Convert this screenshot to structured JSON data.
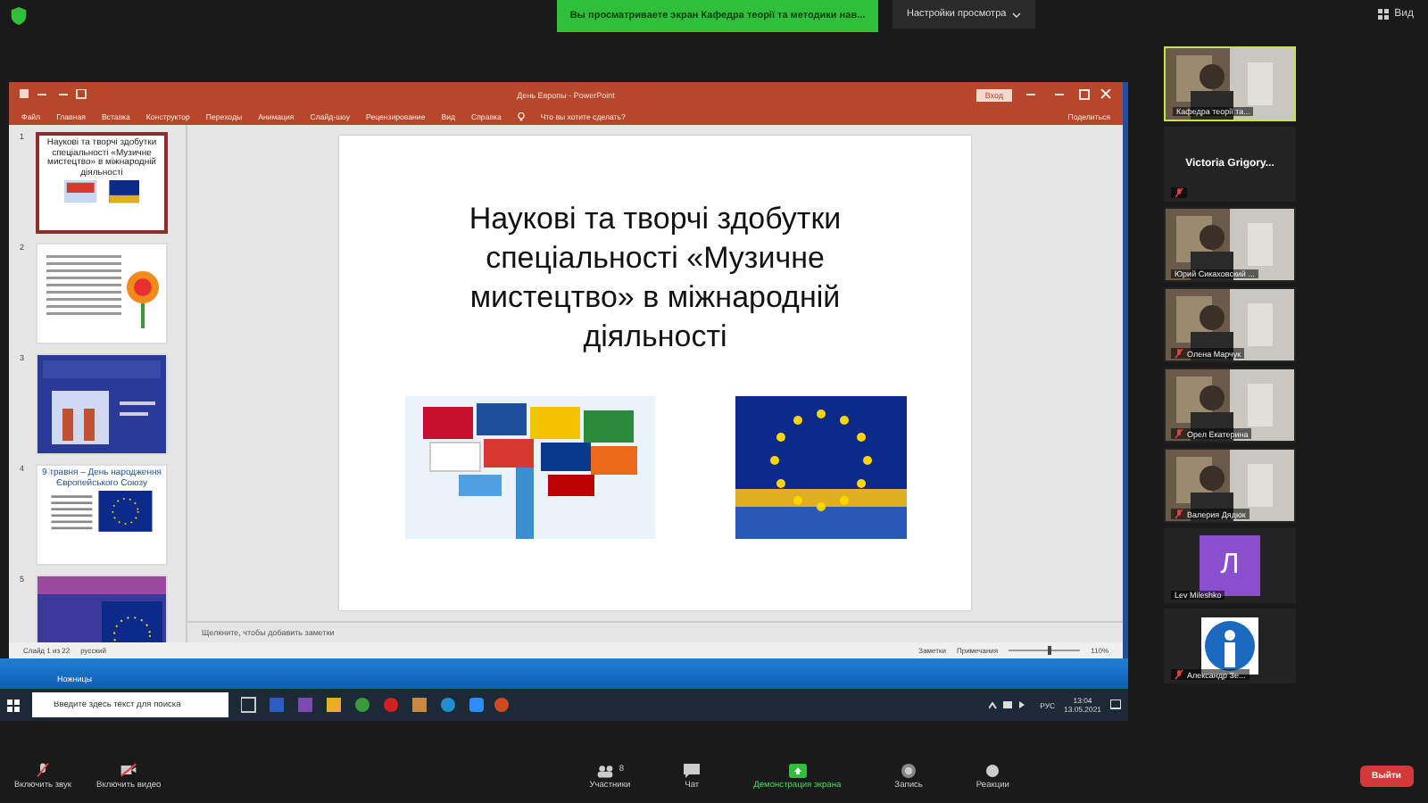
{
  "zoom_top": {
    "sharing_banner": "Вы просматриваете экран Кафедра теорії та методики нав...",
    "view_options": "Настройки просмотра",
    "view": "Вид"
  },
  "powerpoint": {
    "title": "День Европы - PowerPoint",
    "sign_in": "Вход",
    "ribbon_tabs": [
      "Файл",
      "Главная",
      "Вставка",
      "Конструктор",
      "Переходы",
      "Анимация",
      "Слайд-шоу",
      "Рецензирование",
      "Вид",
      "Справка"
    ],
    "tell_me": "Что вы хотите сделать?",
    "share": "Поделиться",
    "thumbnails": [
      {
        "number": "1",
        "selected": true,
        "kind": "title",
        "title": "Наукові та творчі здобутки спеціальності «Музичне мистецтво» в міжнародній діяльності"
      },
      {
        "number": "2",
        "selected": false,
        "kind": "text"
      },
      {
        "number": "3",
        "selected": false,
        "kind": "dark"
      },
      {
        "number": "4",
        "selected": false,
        "kind": "split",
        "title": "9 травня – День народження Європейського Союзу"
      },
      {
        "number": "5",
        "selected": false,
        "kind": "banner"
      }
    ],
    "slide": {
      "title": "Наукові та творчі здобутки спеціальності «Музичне мистецтво» в міжнародній діяльності"
    },
    "notes_placeholder": "Щелкните, чтобы добавить заметки",
    "status_bar": {
      "slide_counter": "Слайд 1 из 22",
      "language": "русский",
      "notes": "Заметки",
      "comments": "Примечания",
      "zoom": "110%",
      "level": 0.55
    }
  },
  "desktop": {
    "icon_label": "Ножницы"
  },
  "taskbar": {
    "search_placeholder": "Введите здесь текст для поиска",
    "language": "РУС",
    "time": "13:04",
    "date": "13.05.2021"
  },
  "participants": [
    {
      "name": "Кафедра теорії та...",
      "kind": "video",
      "muted": false,
      "selected": true
    },
    {
      "name": "Victoria  Grigory...",
      "kind": "name",
      "muted": true,
      "selected": false
    },
    {
      "name": "Юрий Сикаховский ...",
      "kind": "video",
      "muted": false,
      "selected": false
    },
    {
      "name": "Олена Марчук",
      "kind": "video",
      "muted": true,
      "selected": false
    },
    {
      "name": "Орел Екатерина",
      "kind": "video",
      "muted": true,
      "selected": false
    },
    {
      "name": "Валерия Дядюк",
      "kind": "video",
      "muted": true,
      "selected": false
    },
    {
      "name": "Lev Mileshko",
      "kind": "letter",
      "letter": "Л",
      "muted": false,
      "selected": false
    },
    {
      "name": "Александр Зе...",
      "kind": "icon",
      "muted": true,
      "selected": false
    }
  ],
  "toolbar": {
    "audio": "Включить звук",
    "video": "Включить видео",
    "participants": "Участники",
    "participants_count": "8",
    "chat": "Чат",
    "share_screen": "Демонстрация экрана",
    "record": "Запись",
    "reactions": "Реакции",
    "leave": "Выйти"
  }
}
